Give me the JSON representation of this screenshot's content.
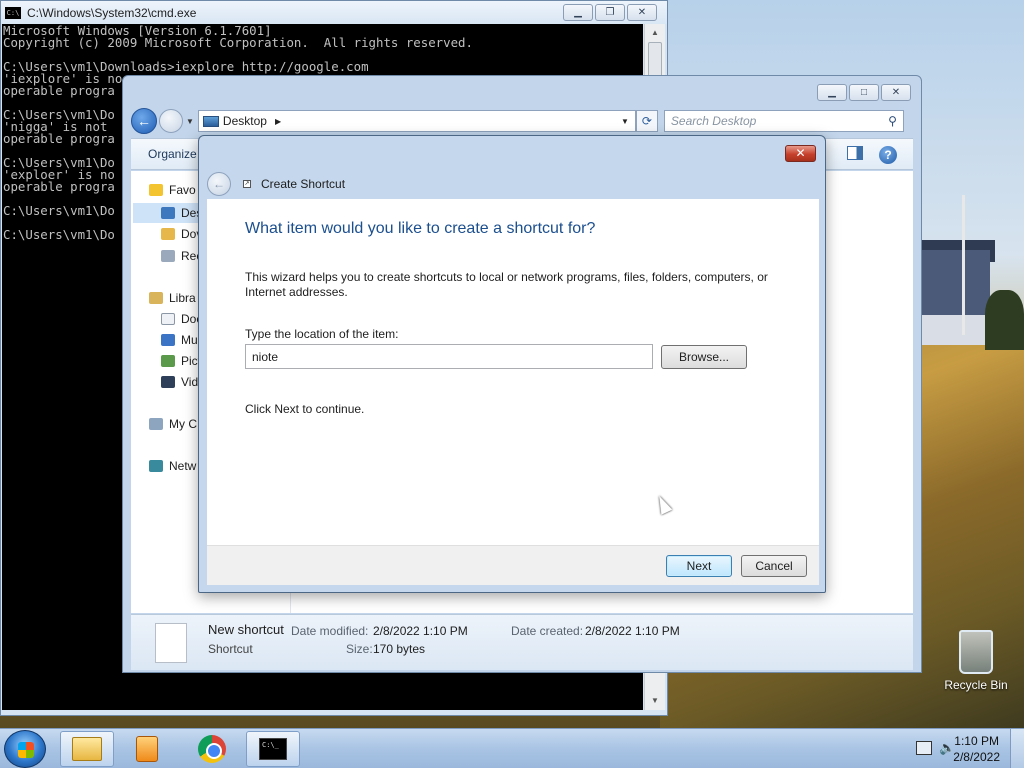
{
  "cmd": {
    "title": "C:\\Windows\\System32\\cmd.exe",
    "icon_text": "C:\\",
    "lines": [
      "Microsoft Windows [Version 6.1.7601]",
      "Copyright (c) 2009 Microsoft Corporation.  All rights reserved.",
      "",
      "C:\\Users\\vm1\\Downloads>iexplore http://google.com",
      "'iexplore' is no",
      "operable progra",
      "",
      "C:\\Users\\vm1\\Do",
      "'nigga' is not ",
      "operable progra",
      "",
      "C:\\Users\\vm1\\Do",
      "'exploer' is no",
      "operable progra",
      "",
      "C:\\Users\\vm1\\Do",
      "",
      "C:\\Users\\vm1\\Do"
    ]
  },
  "explorer": {
    "address": "Desktop",
    "search_placeholder": "Search Desktop",
    "organize_label": "Organize",
    "nav": {
      "favorites": "Favo",
      "desktop": "Des",
      "downloads": "Dov",
      "recent": "Rec",
      "libraries": "Libra",
      "documents": "Doc",
      "music": "Mu",
      "pictures": "Pict",
      "videos": "Vid",
      "computer": "My C",
      "network": "Netw"
    },
    "status": {
      "name": "New shortcut",
      "type": "Shortcut",
      "modified_label": "Date modified:",
      "modified_value": "2/8/2022 1:10 PM",
      "created_label": "Date created:",
      "created_value": "2/8/2022 1:10 PM",
      "size_label": "Size:",
      "size_value": "170 bytes"
    }
  },
  "dialog": {
    "title": "Create Shortcut",
    "question": "What item would you like to create a shortcut for?",
    "description": "This wizard helps you to create shortcuts to local or network programs, files, folders, computers, or Internet addresses.",
    "location_label": "Type the location of the item:",
    "location_value": "niote",
    "browse_label": "Browse...",
    "continue_hint": "Click Next to continue.",
    "next_label": "Next",
    "cancel_label": "Cancel",
    "close_glyph": "✕"
  },
  "desktop": {
    "recycle_bin_label": "Recycle Bin"
  },
  "taskbar": {
    "clock_time": "1:10 PM",
    "clock_date": "2/8/2022",
    "cmd_icon_text": "C:\\_"
  }
}
